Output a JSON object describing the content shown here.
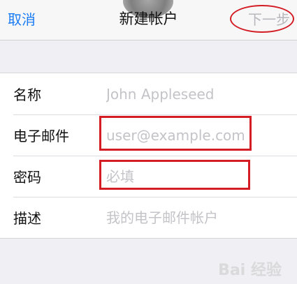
{
  "nav": {
    "cancel_label": "取消",
    "title": "新建帐户",
    "next_label": "下一步"
  },
  "form": {
    "name": {
      "label": "名称",
      "placeholder": "John Appleseed",
      "value": ""
    },
    "email": {
      "label": "电子邮件",
      "placeholder": "user@example.com",
      "value": ""
    },
    "password": {
      "label": "密码",
      "placeholder": "必填",
      "value": ""
    },
    "description": {
      "label": "描述",
      "placeholder": "我的电子邮件帐户",
      "value": ""
    }
  },
  "watermark": {
    "text": "Bai 经验"
  },
  "colors": {
    "accent": "#1a7cf5",
    "disabled": "#b7b7bc",
    "highlight": "#d31c24",
    "background": "#efeff4"
  }
}
